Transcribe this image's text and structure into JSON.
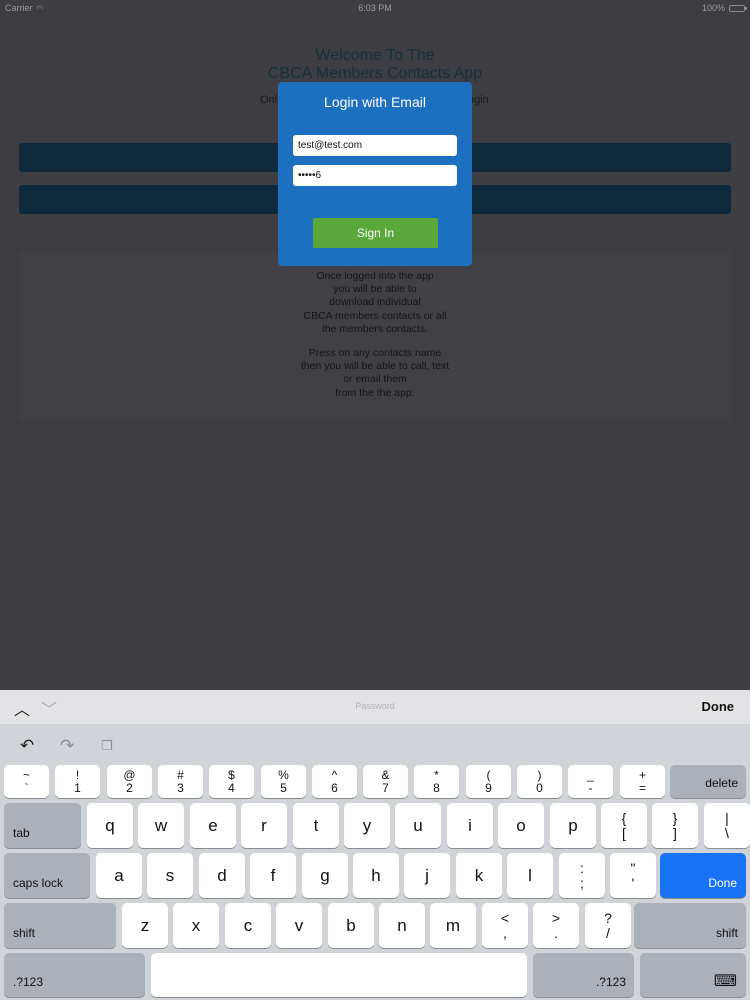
{
  "status_bar": {
    "carrier": "Carrier",
    "time": "6:03 PM",
    "battery": "100%"
  },
  "background": {
    "title_line1": "Welcome To The",
    "title_line2": "CBCA Members Contacts App",
    "sub_left": "Onl",
    "sub_right": "ogin",
    "info_para1": "Once logged into the app\nyou will be able to\ndownload individual\nCBCA members contacts or all\nthe members contacts.",
    "info_para2": "Press on any contacts name\nthen you will be able to call, text\nor email them\nfrom the the app."
  },
  "login_modal": {
    "title": "Login with Email",
    "email_value": "test@test.com",
    "password_value": "•••••6",
    "signin_label": "Sign In"
  },
  "accessory_bar": {
    "field_label": "Password",
    "done_label": "Done"
  },
  "keyboard": {
    "number_row": [
      {
        "top": "~",
        "bottom": "`"
      },
      {
        "top": "!",
        "bottom": "1"
      },
      {
        "top": "@",
        "bottom": "2"
      },
      {
        "top": "#",
        "bottom": "3"
      },
      {
        "top": "$",
        "bottom": "4"
      },
      {
        "top": "%",
        "bottom": "5"
      },
      {
        "top": "^",
        "bottom": "6"
      },
      {
        "top": "&",
        "bottom": "7"
      },
      {
        "top": "*",
        "bottom": "8"
      },
      {
        "top": "(",
        "bottom": "9"
      },
      {
        "top": ")",
        "bottom": "0"
      },
      {
        "top": "_",
        "bottom": "-"
      },
      {
        "top": "+",
        "bottom": "="
      }
    ],
    "delete_label": "delete",
    "tab_label": "tab",
    "row_q": [
      "q",
      "w",
      "e",
      "r",
      "t",
      "y",
      "u",
      "i",
      "o",
      "p"
    ],
    "row_q_symbols": [
      {
        "top": "{",
        "bottom": "["
      },
      {
        "top": "}",
        "bottom": "]"
      },
      {
        "top": "|",
        "bottom": "\\"
      }
    ],
    "caps_label": "caps lock",
    "row_a": [
      "a",
      "s",
      "d",
      "f",
      "g",
      "h",
      "j",
      "k",
      "l"
    ],
    "row_a_symbols": [
      {
        "top": ":",
        "bottom": ";"
      },
      {
        "top": "\"",
        "bottom": "'"
      }
    ],
    "done_label": "Done",
    "shift_label": "shift",
    "row_z": [
      "z",
      "x",
      "c",
      "v",
      "b",
      "n",
      "m"
    ],
    "row_z_symbols": [
      {
        "top": "<",
        "bottom": ","
      },
      {
        "top": ">",
        "bottom": "."
      },
      {
        "top": "?",
        "bottom": "/"
      }
    ],
    "numbers_label": ".?123"
  }
}
